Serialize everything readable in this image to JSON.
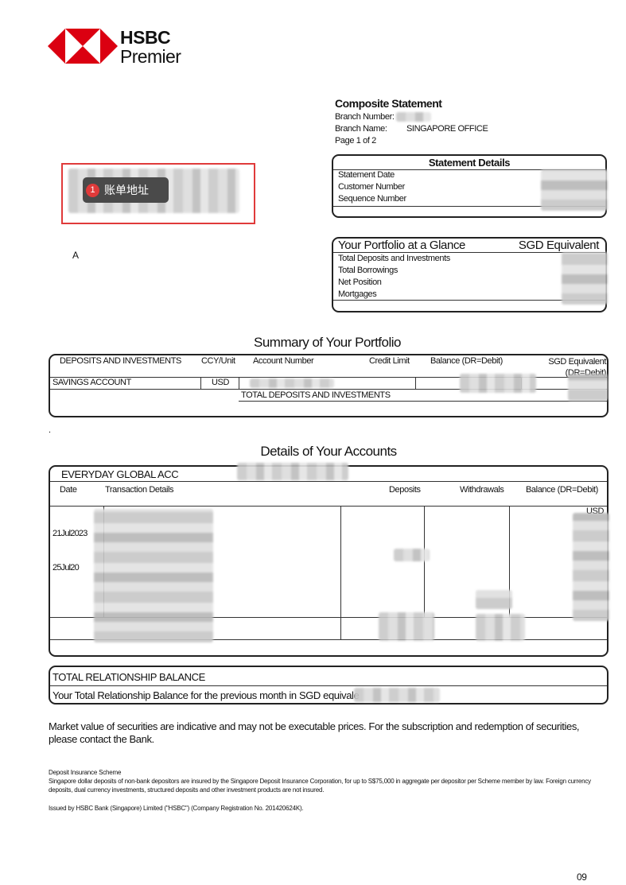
{
  "brand": {
    "name": "HSBC",
    "tier": "Premier",
    "logo_color": "#db0011"
  },
  "statement": {
    "title": "Composite Statement",
    "branch_number_label": "Branch Number:",
    "branch_name_label": "Branch Name:",
    "branch_name_value": "SINGAPORE OFFICE",
    "page": "Page 1 of 2"
  },
  "address": {
    "badge_number": "1",
    "tooltip": "账单地址",
    "annotation_color": "#e03a3a",
    "letter": "A"
  },
  "statement_details": {
    "title": "Statement Details",
    "rows": [
      "Statement Date",
      "Customer Number",
      "Sequence Number"
    ]
  },
  "portfolio_glance": {
    "title": "Your Portfolio at a Glance",
    "currency": "SGD Equivalent",
    "rows": [
      "Total Deposits and Investments",
      "Total Borrowings",
      "Net Position",
      "Mortgages"
    ]
  },
  "summary": {
    "title": "Summary of Your Portfolio",
    "headers": {
      "col1": "DEPOSITS AND INVESTMENTS",
      "col2": "CCY/Unit",
      "col3": "Account Number",
      "col4": "Credit Limit",
      "col5": "Balance (DR=Debit)",
      "col6": "SGD Equivalent (DR=Debit)"
    },
    "row": {
      "type": "SAVINGS ACCOUNT",
      "ccy": "USD"
    },
    "total_label": "TOTAL DEPOSITS AND INVESTMENTS"
  },
  "dot": ".",
  "details": {
    "title": "Details of Your Accounts",
    "account_name": "EVERYDAY GLOBAL ACC",
    "headers": {
      "date": "Date",
      "details": "Transaction Details",
      "deposits": "Deposits",
      "withdrawals": "Withdrawals",
      "balance": "Balance (DR=Debit)"
    },
    "currency": "USD",
    "dates": [
      "21Jul2023",
      "25Jul20"
    ]
  },
  "relationship": {
    "title": "TOTAL RELATIONSHIP BALANCE",
    "text": "Your Total Relationship Balance for the previous month in SGD equivale"
  },
  "notes": {
    "market": "Market value of securities are indicative and may not be executable prices. For the subscription and redemption of securities, please contact the Bank.",
    "deposit_title": "Deposit Insurance Scheme",
    "deposit_text": "Singapore dollar deposits of non-bank depositors are insured by the Singapore Deposit Insurance Corporation, for up to S$75,000 in aggregate per depositor per Scheme member by law. Foreign currency deposits, dual currency investments, structured deposits and other investment products are not insured.",
    "issued": "Issued by HSBC Bank (Singapore) Limited (\"HSBC\") (Company Registration No. 201420624K)."
  },
  "page_number": "09"
}
